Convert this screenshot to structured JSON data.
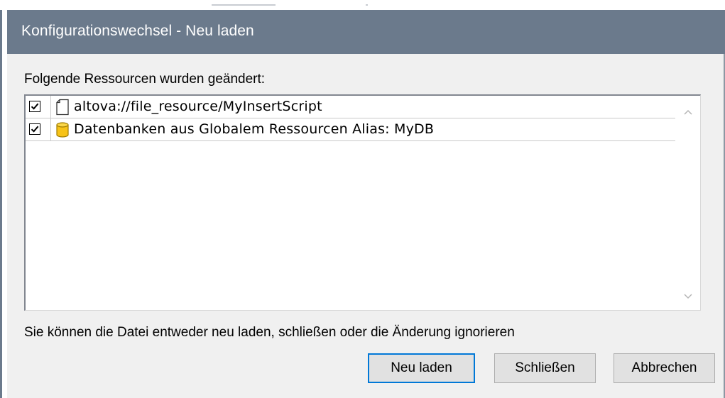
{
  "window": {
    "title": "Konfigurationswechsel - Neu laden"
  },
  "resources": {
    "heading": "Folgende Ressourcen wurden geändert:",
    "items": [
      {
        "label": "altova://file_resource/MyInsertScript",
        "checked": true,
        "icon": "file-icon"
      },
      {
        "label": "Datenbanken aus Globalem Ressourcen Alias: MyDB",
        "checked": true,
        "icon": "database-icon"
      }
    ]
  },
  "message": "Sie können die Datei entweder neu laden, schließen oder die Änderung ignorieren",
  "buttons": {
    "reload": "Neu laden",
    "close": "Schließen",
    "cancel": "Abbrechen"
  },
  "colors": {
    "titlebar": "#6b7a8c",
    "accent": "#0078d7",
    "database": "#f7c318"
  }
}
